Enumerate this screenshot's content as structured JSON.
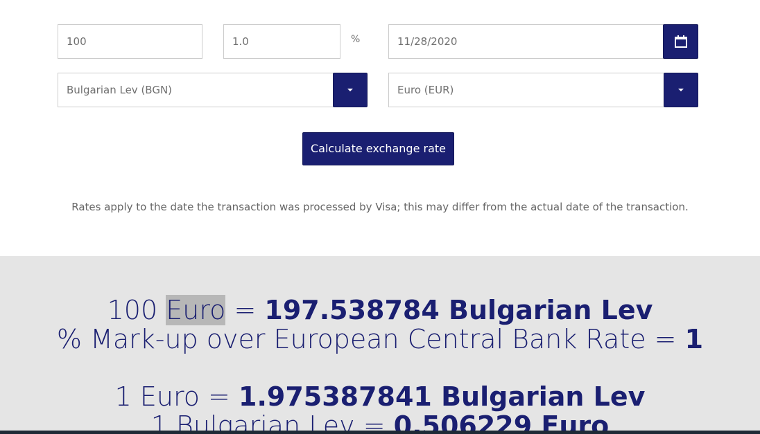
{
  "form": {
    "amount": "100",
    "markup": "1.0",
    "percent_symbol": "%",
    "date": "11/28/2020",
    "from_currency": "Bulgarian Lev (BGN)",
    "to_currency": "Euro (EUR)",
    "calculate_label": "Calculate exchange rate"
  },
  "note": "Rates apply to the date the transaction was processed by Visa; this may differ from the actual date of the transaction.",
  "results": {
    "line1_prefix": "100",
    "line1_currency": "Euro",
    "line1_equals": "=",
    "line1_value": "197.538784 Bulgarian Lev",
    "line2_text": "% Mark-up over European Central Bank Rate =",
    "line2_value": "1",
    "line3_text": "1 Euro =",
    "line3_value": "1.975387841 Bulgarian Lev",
    "line4_text": "1 Bulgarian Lev =",
    "line4_value": "0.506229 Euro"
  },
  "colors": {
    "accent": "#1a1f71",
    "results_bg": "#e5e5e5"
  },
  "icons": [
    "calendar-icon",
    "chevron-down-icon"
  ]
}
